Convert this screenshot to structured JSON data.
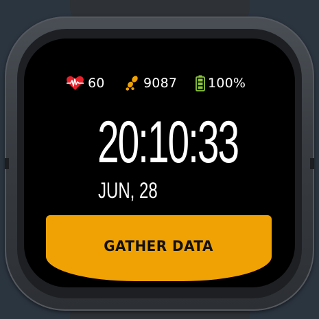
{
  "status": {
    "heart_rate": "60",
    "steps": "9087",
    "battery": "100%"
  },
  "clock": {
    "time": "20:10:33",
    "date": "JUN, 28"
  },
  "action": {
    "label": "GATHER DATA"
  },
  "colors": {
    "background": "#2b3540",
    "screen": "#000000",
    "accent": "#f0a204",
    "heart": "#e8202a",
    "steps": "#f0a204",
    "battery": "#8cc63f"
  },
  "icons": {
    "heart": "heart-pulse-icon",
    "steps": "footsteps-icon",
    "battery": "battery-full-icon"
  }
}
